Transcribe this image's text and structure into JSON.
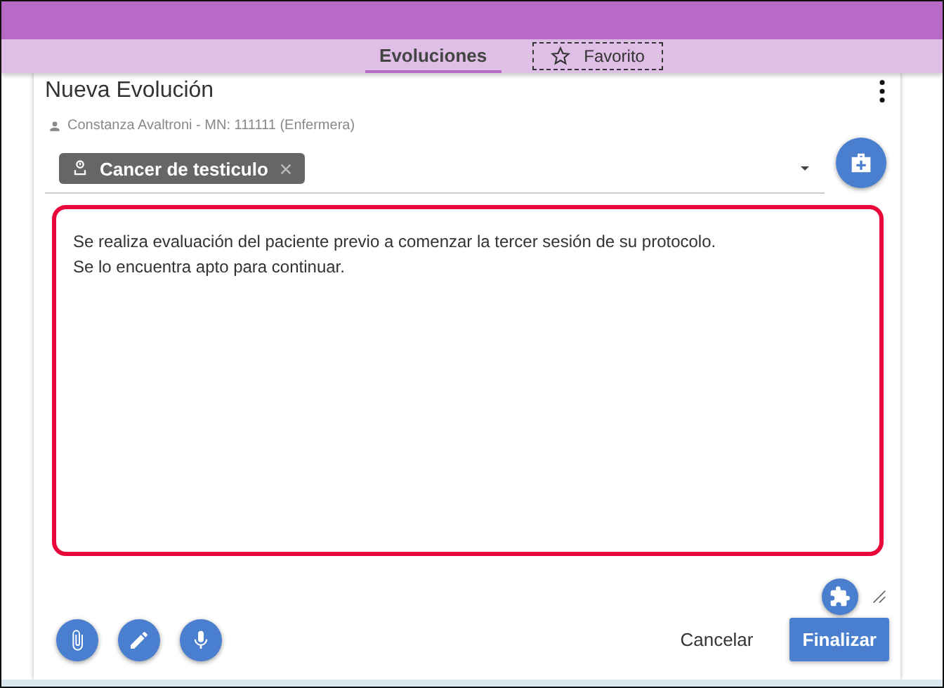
{
  "tabs": [
    {
      "label": "Evoluciones",
      "selected": true,
      "kind": "text"
    },
    {
      "label": "Favorito",
      "selected": false,
      "kind": "favorite"
    }
  ],
  "card": {
    "title": "Nueva Evolución",
    "author": "Constanza Avaltroni - MN: 111111 (Enfermera)",
    "chips": [
      {
        "label": "Cancer de testiculo"
      }
    ],
    "note": {
      "lines": [
        "Se realiza evaluación del paciente previo a comenzar la tercer sesión de su protocolo.",
        "Se lo encuentra apto para continuar."
      ]
    },
    "actions": [
      {
        "label": "Cancelar",
        "kind": "text"
      },
      {
        "label": "Finalizar",
        "kind": "primary"
      }
    ]
  }
}
